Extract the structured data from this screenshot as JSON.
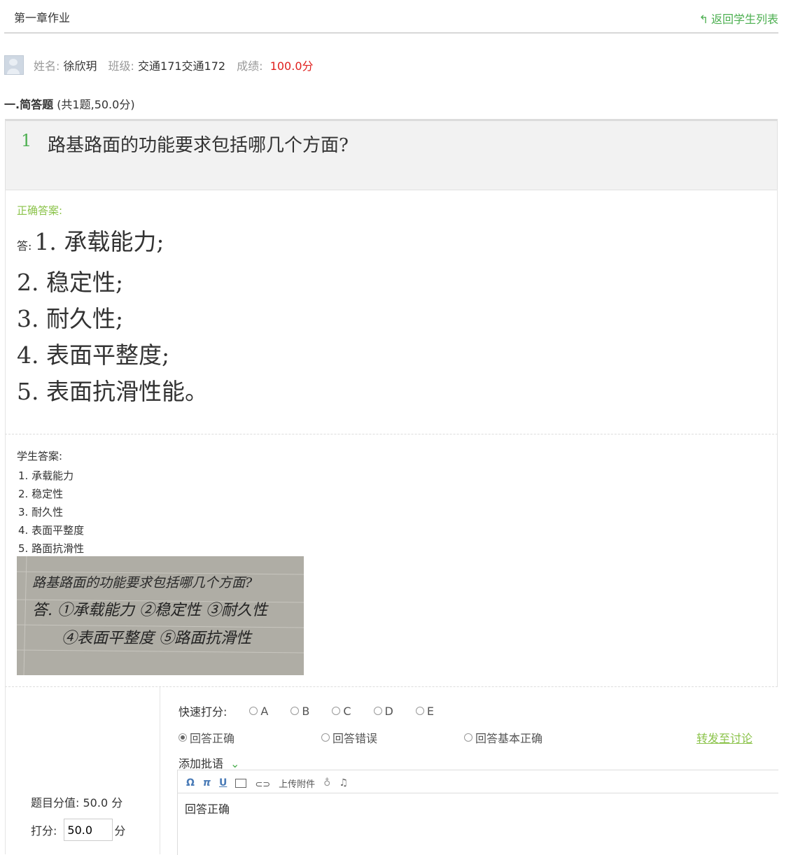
{
  "header": {
    "title": "第一章作业",
    "back_label": "返回学生列表",
    "back_icon": "back-arrow-icon"
  },
  "student": {
    "name_label": "姓名:",
    "name": "徐欣玥",
    "class_label": "班级:",
    "class": "交通171交通172",
    "score_label": "成绩:",
    "score": "100.0分"
  },
  "section": {
    "heading": "一.简答题",
    "meta": "(共1题,50.0分)"
  },
  "question": {
    "number": "1",
    "text": "路基路面的功能要求包括哪几个方面?"
  },
  "correct_answer": {
    "label": "正确答案:",
    "prefix": "答:",
    "lines": [
      "1. 承载能力;",
      "2. 稳定性;",
      "3. 耐久性;",
      "4. 表面平整度;",
      "5. 表面抗滑性能。"
    ]
  },
  "student_answer": {
    "label": "学生答案:",
    "lines": [
      "1. 承载能力",
      "2. 稳定性",
      "3. 耐久性",
      "4. 表面平整度",
      "5. 路面抗滑性"
    ],
    "photo_text": [
      "路基路面的功能要求包括哪几个方面?",
      "答. ①承载能力 ②稳定性 ③耐久性",
      "④表面平整度 ⑤路面抗滑性"
    ]
  },
  "grading": {
    "quick_label": "快速打分:",
    "quick_options": [
      "A",
      "B",
      "C",
      "D",
      "E"
    ],
    "verdicts": [
      "回答正确",
      "回答错误",
      "回答基本正确"
    ],
    "selected_verdict": "回答正确",
    "forward_label": "转发至讨论",
    "comment_label": "添加批语",
    "toolbar": {
      "omega": "Ω",
      "pi": "π",
      "underline": "U",
      "upload": "上传附件",
      "music": "♫"
    },
    "comment_text": "回答正确",
    "question_value_label": "题目分值:",
    "question_value": "50.0 分",
    "score_label": "打分:",
    "score_value": "50.0",
    "score_unit": "分"
  },
  "colors": {
    "accent": "#4caf50",
    "score_red": "#e0201e",
    "label_green": "#8bc34a"
  }
}
